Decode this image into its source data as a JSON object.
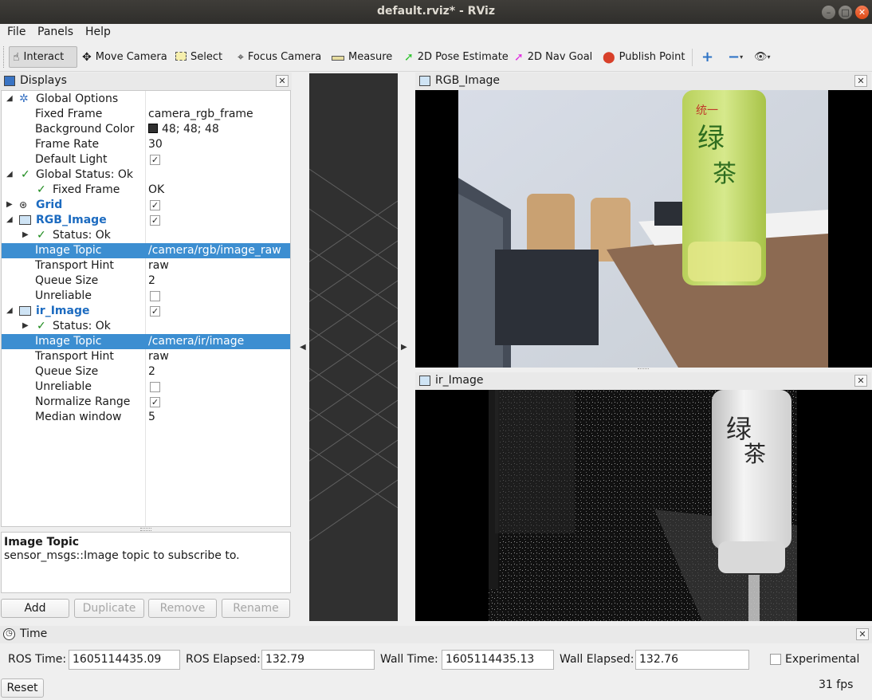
{
  "window": {
    "title": "default.rviz* - RViz"
  },
  "menu": {
    "file": "File",
    "panels": "Panels",
    "help": "Help"
  },
  "toolbar": {
    "interact": "Interact",
    "move_camera": "Move Camera",
    "select": "Select",
    "focus_camera": "Focus Camera",
    "measure": "Measure",
    "pose_estimate": "2D Pose Estimate",
    "nav_goal": "2D Nav Goal",
    "publish_point": "Publish Point"
  },
  "displays": {
    "title": "Displays",
    "rows": {
      "global_options": "Global Options",
      "fixed_frame": "Fixed Frame",
      "fixed_frame_val": "camera_rgb_frame",
      "background_color": "Background Color",
      "background_color_val": "48; 48; 48",
      "frame_rate": "Frame Rate",
      "frame_rate_val": "30",
      "default_light": "Default Light",
      "global_status": "Global Status: Ok",
      "status_fixed_frame": "Fixed Frame",
      "status_fixed_frame_val": "OK",
      "grid": "Grid",
      "rgb_image": "RGB_Image",
      "rgb_status": "Status: Ok",
      "rgb_topic": "Image Topic",
      "rgb_topic_val": "/camera/rgb/image_raw",
      "rgb_hint": "Transport Hint",
      "rgb_hint_val": "raw",
      "rgb_queue": "Queue Size",
      "rgb_queue_val": "2",
      "rgb_unreliable": "Unreliable",
      "ir_image": "ir_Image",
      "ir_status": "Status: Ok",
      "ir_topic": "Image Topic",
      "ir_topic_val": "/camera/ir/image",
      "ir_hint": "Transport Hint",
      "ir_hint_val": "raw",
      "ir_queue": "Queue Size",
      "ir_queue_val": "2",
      "ir_unreliable": "Unreliable",
      "ir_normalize": "Normalize Range",
      "ir_median": "Median window",
      "ir_median_val": "5"
    },
    "checks": {
      "default_light": true,
      "grid": true,
      "rgb_image": true,
      "rgb_unreliable": false,
      "ir_image": true,
      "ir_unreliable": false,
      "ir_normalize": true
    },
    "background_color_hex": "#303030",
    "description_title": "Image Topic",
    "description_text": "sensor_msgs::Image topic to subscribe to.",
    "buttons": {
      "add": "Add",
      "duplicate": "Duplicate",
      "remove": "Remove",
      "rename": "Rename"
    }
  },
  "panels": {
    "rgb_title": "RGB_Image",
    "ir_title": "ir_Image",
    "rgb_label_1": "统一",
    "rgb_label_2": "绿",
    "rgb_label_3": "茶",
    "ir_label_1": "绿",
    "ir_label_2": "茶"
  },
  "time": {
    "title": "Time",
    "ros_time_label": "ROS Time:",
    "ros_time": "1605114435.09",
    "ros_elapsed_label": "ROS Elapsed:",
    "ros_elapsed": "132.79",
    "wall_time_label": "Wall Time:",
    "wall_time": "1605114435.13",
    "wall_elapsed_label": "Wall Elapsed:",
    "wall_elapsed": "132.76",
    "experimental": "Experimental",
    "experimental_checked": false,
    "reset": "Reset",
    "fps": "31 fps"
  },
  "colors": {
    "accent": "#3c8ed1",
    "title_bar": "#2f2e2b",
    "close_button": "#df4a16",
    "viewport_bg": "#303030"
  }
}
